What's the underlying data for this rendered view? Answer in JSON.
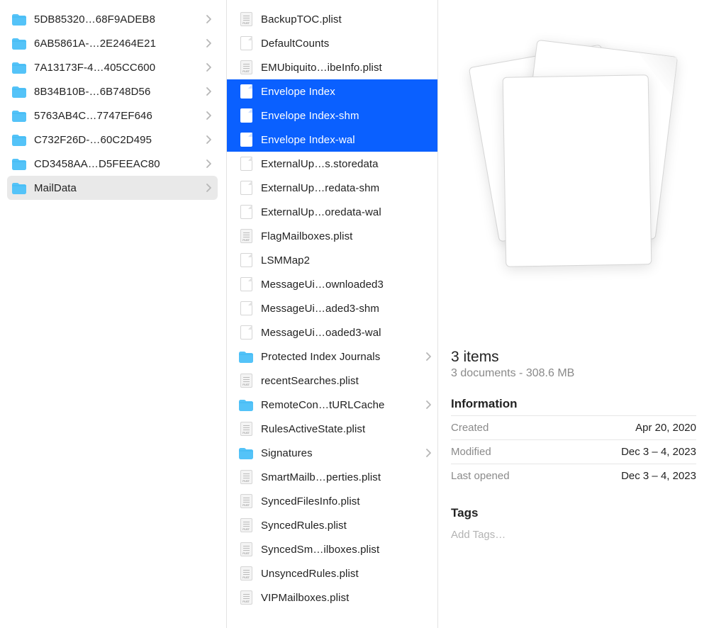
{
  "col1": {
    "items": [
      {
        "label": "5DB85320…68F9ADEB8",
        "type": "folder",
        "has_children": true,
        "active": false
      },
      {
        "label": "6AB5861A-…2E2464E21",
        "type": "folder",
        "has_children": true,
        "active": false
      },
      {
        "label": "7A13173F-4…405CC600",
        "type": "folder",
        "has_children": true,
        "active": false
      },
      {
        "label": "8B34B10B-…6B748D56",
        "type": "folder",
        "has_children": true,
        "active": false
      },
      {
        "label": "5763AB4C…7747EF646",
        "type": "folder",
        "has_children": true,
        "active": false
      },
      {
        "label": "C732F26D-…60C2D495",
        "type": "folder",
        "has_children": true,
        "active": false
      },
      {
        "label": "CD3458AA…D5FEEAC80",
        "type": "folder",
        "has_children": true,
        "active": false
      },
      {
        "label": "MailData",
        "type": "folder",
        "has_children": true,
        "active": true
      }
    ]
  },
  "col2": {
    "items": [
      {
        "label": "BackupTOC.plist",
        "type": "plist",
        "has_children": false,
        "selected": false
      },
      {
        "label": "DefaultCounts",
        "type": "blank",
        "has_children": false,
        "selected": false
      },
      {
        "label": "EMUbiquito…ibeInfo.plist",
        "type": "plist",
        "has_children": false,
        "selected": false
      },
      {
        "label": "Envelope Index",
        "type": "blank",
        "has_children": false,
        "selected": true
      },
      {
        "label": "Envelope Index-shm",
        "type": "blank",
        "has_children": false,
        "selected": true
      },
      {
        "label": "Envelope Index-wal",
        "type": "blank",
        "has_children": false,
        "selected": true
      },
      {
        "label": "ExternalUp…s.storedata",
        "type": "blank",
        "has_children": false,
        "selected": false
      },
      {
        "label": "ExternalUp…redata-shm",
        "type": "blank",
        "has_children": false,
        "selected": false
      },
      {
        "label": "ExternalUp…oredata-wal",
        "type": "blank",
        "has_children": false,
        "selected": false
      },
      {
        "label": "FlagMailboxes.plist",
        "type": "plist",
        "has_children": false,
        "selected": false
      },
      {
        "label": "LSMMap2",
        "type": "blank",
        "has_children": false,
        "selected": false
      },
      {
        "label": "MessageUi…ownloaded3",
        "type": "blank",
        "has_children": false,
        "selected": false
      },
      {
        "label": "MessageUi…aded3-shm",
        "type": "blank",
        "has_children": false,
        "selected": false
      },
      {
        "label": "MessageUi…oaded3-wal",
        "type": "blank",
        "has_children": false,
        "selected": false
      },
      {
        "label": "Protected Index Journals",
        "type": "folder",
        "has_children": true,
        "selected": false
      },
      {
        "label": "recentSearches.plist",
        "type": "plist",
        "has_children": false,
        "selected": false
      },
      {
        "label": "RemoteCon…tURLCache",
        "type": "folder",
        "has_children": true,
        "selected": false
      },
      {
        "label": "RulesActiveState.plist",
        "type": "plist",
        "has_children": false,
        "selected": false
      },
      {
        "label": "Signatures",
        "type": "folder",
        "has_children": true,
        "selected": false
      },
      {
        "label": "SmartMailb…perties.plist",
        "type": "plist",
        "has_children": false,
        "selected": false
      },
      {
        "label": "SyncedFilesInfo.plist",
        "type": "plist",
        "has_children": false,
        "selected": false
      },
      {
        "label": "SyncedRules.plist",
        "type": "plist",
        "has_children": false,
        "selected": false
      },
      {
        "label": "SyncedSm…ilboxes.plist",
        "type": "plist",
        "has_children": false,
        "selected": false
      },
      {
        "label": "UnsyncedRules.plist",
        "type": "plist",
        "has_children": false,
        "selected": false
      },
      {
        "label": "VIPMailboxes.plist",
        "type": "plist",
        "has_children": false,
        "selected": false
      }
    ]
  },
  "preview": {
    "title": "3 items",
    "subtitle": "3 documents - 308.6 MB",
    "info_heading": "Information",
    "rows": [
      {
        "k": "Created",
        "v": "Apr 20, 2020"
      },
      {
        "k": "Modified",
        "v": "Dec 3 – 4, 2023"
      },
      {
        "k": "Last opened",
        "v": "Dec 3 – 4, 2023"
      }
    ],
    "tags_heading": "Tags",
    "tags_placeholder": "Add Tags…"
  }
}
